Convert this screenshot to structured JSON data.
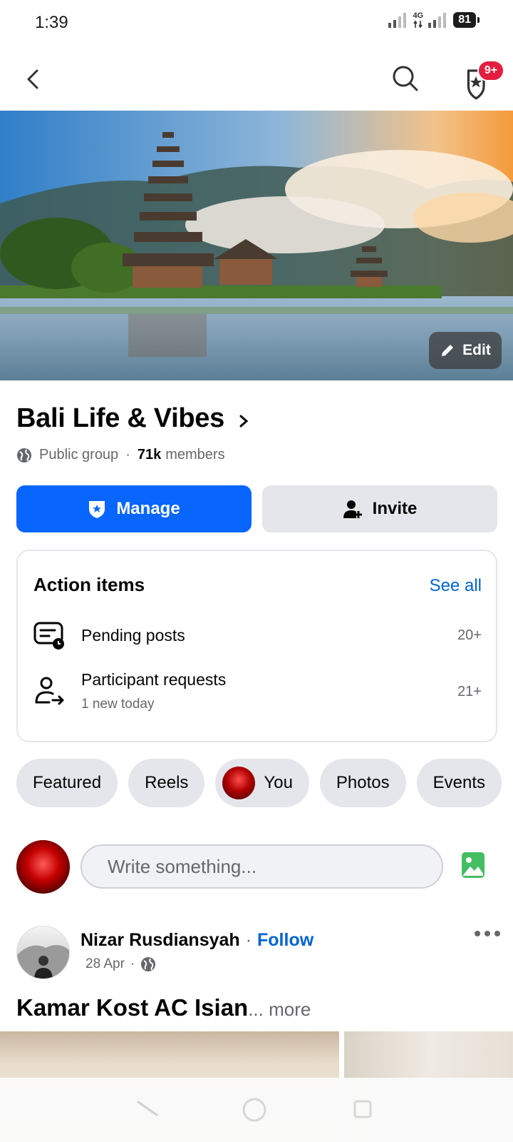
{
  "status_bar": {
    "time": "1:39",
    "network": "4G",
    "battery": "81"
  },
  "top_nav": {
    "notification_badge": "9+"
  },
  "cover": {
    "edit_label": "Edit"
  },
  "group": {
    "name": "Bali Life & Vibes",
    "privacy": "Public group",
    "separator": "·",
    "member_count": "71k",
    "member_suffix": "members"
  },
  "buttons": {
    "manage": "Manage",
    "invite": "Invite"
  },
  "action_items": {
    "title": "Action items",
    "see_all": "See all",
    "rows": [
      {
        "label": "Pending posts",
        "sub": "",
        "count": "20+"
      },
      {
        "label": "Participant requests",
        "sub": "1 new today",
        "count": "21+"
      }
    ]
  },
  "chips": [
    "Featured",
    "Reels",
    "You",
    "Photos",
    "Events"
  ],
  "composer": {
    "placeholder": "Write something..."
  },
  "post": {
    "author": "Nizar Rusdiansyah",
    "dot": "·",
    "follow": "Follow",
    "date": "28 Apr",
    "meta_dot": "·",
    "title": "Kamar Kost AC Isian",
    "more": "... more"
  },
  "colors": {
    "primary": "#0866ff",
    "link": "#0064d1",
    "badge": "#e41e3f",
    "chip_bg": "#e4e6eb",
    "secondary_text": "#65676b"
  }
}
